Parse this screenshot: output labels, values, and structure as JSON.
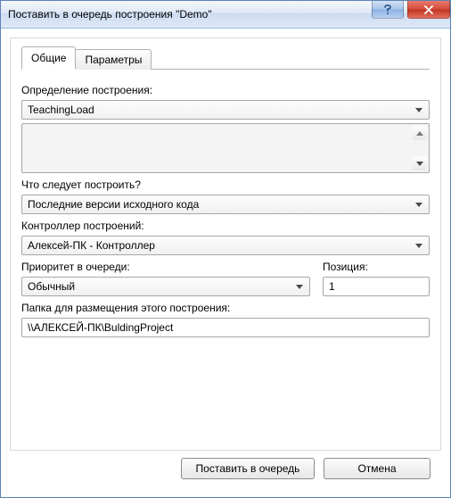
{
  "window": {
    "title": "Поставить в очередь построения \"Demo\""
  },
  "tabs": {
    "general": "Общие",
    "parameters": "Параметры"
  },
  "form": {
    "build_definition_label": "Определение построения:",
    "build_definition_value": "TeachingLoad",
    "what_to_build_label": "Что следует построить?",
    "what_to_build_value": "Последние версии исходного кода",
    "controller_label": "Контроллер построений:",
    "controller_value": "Алексей-ПК - Контроллер",
    "priority_label": "Приоритет в очереди:",
    "priority_value": "Обычный",
    "position_label": "Позиция:",
    "position_value": "1",
    "folder_label": "Папка для размещения этого построения:",
    "folder_value": "\\\\АЛЕКСЕЙ-ПК\\BuldingProject"
  },
  "buttons": {
    "queue": "Поставить в очередь",
    "cancel": "Отмена"
  }
}
